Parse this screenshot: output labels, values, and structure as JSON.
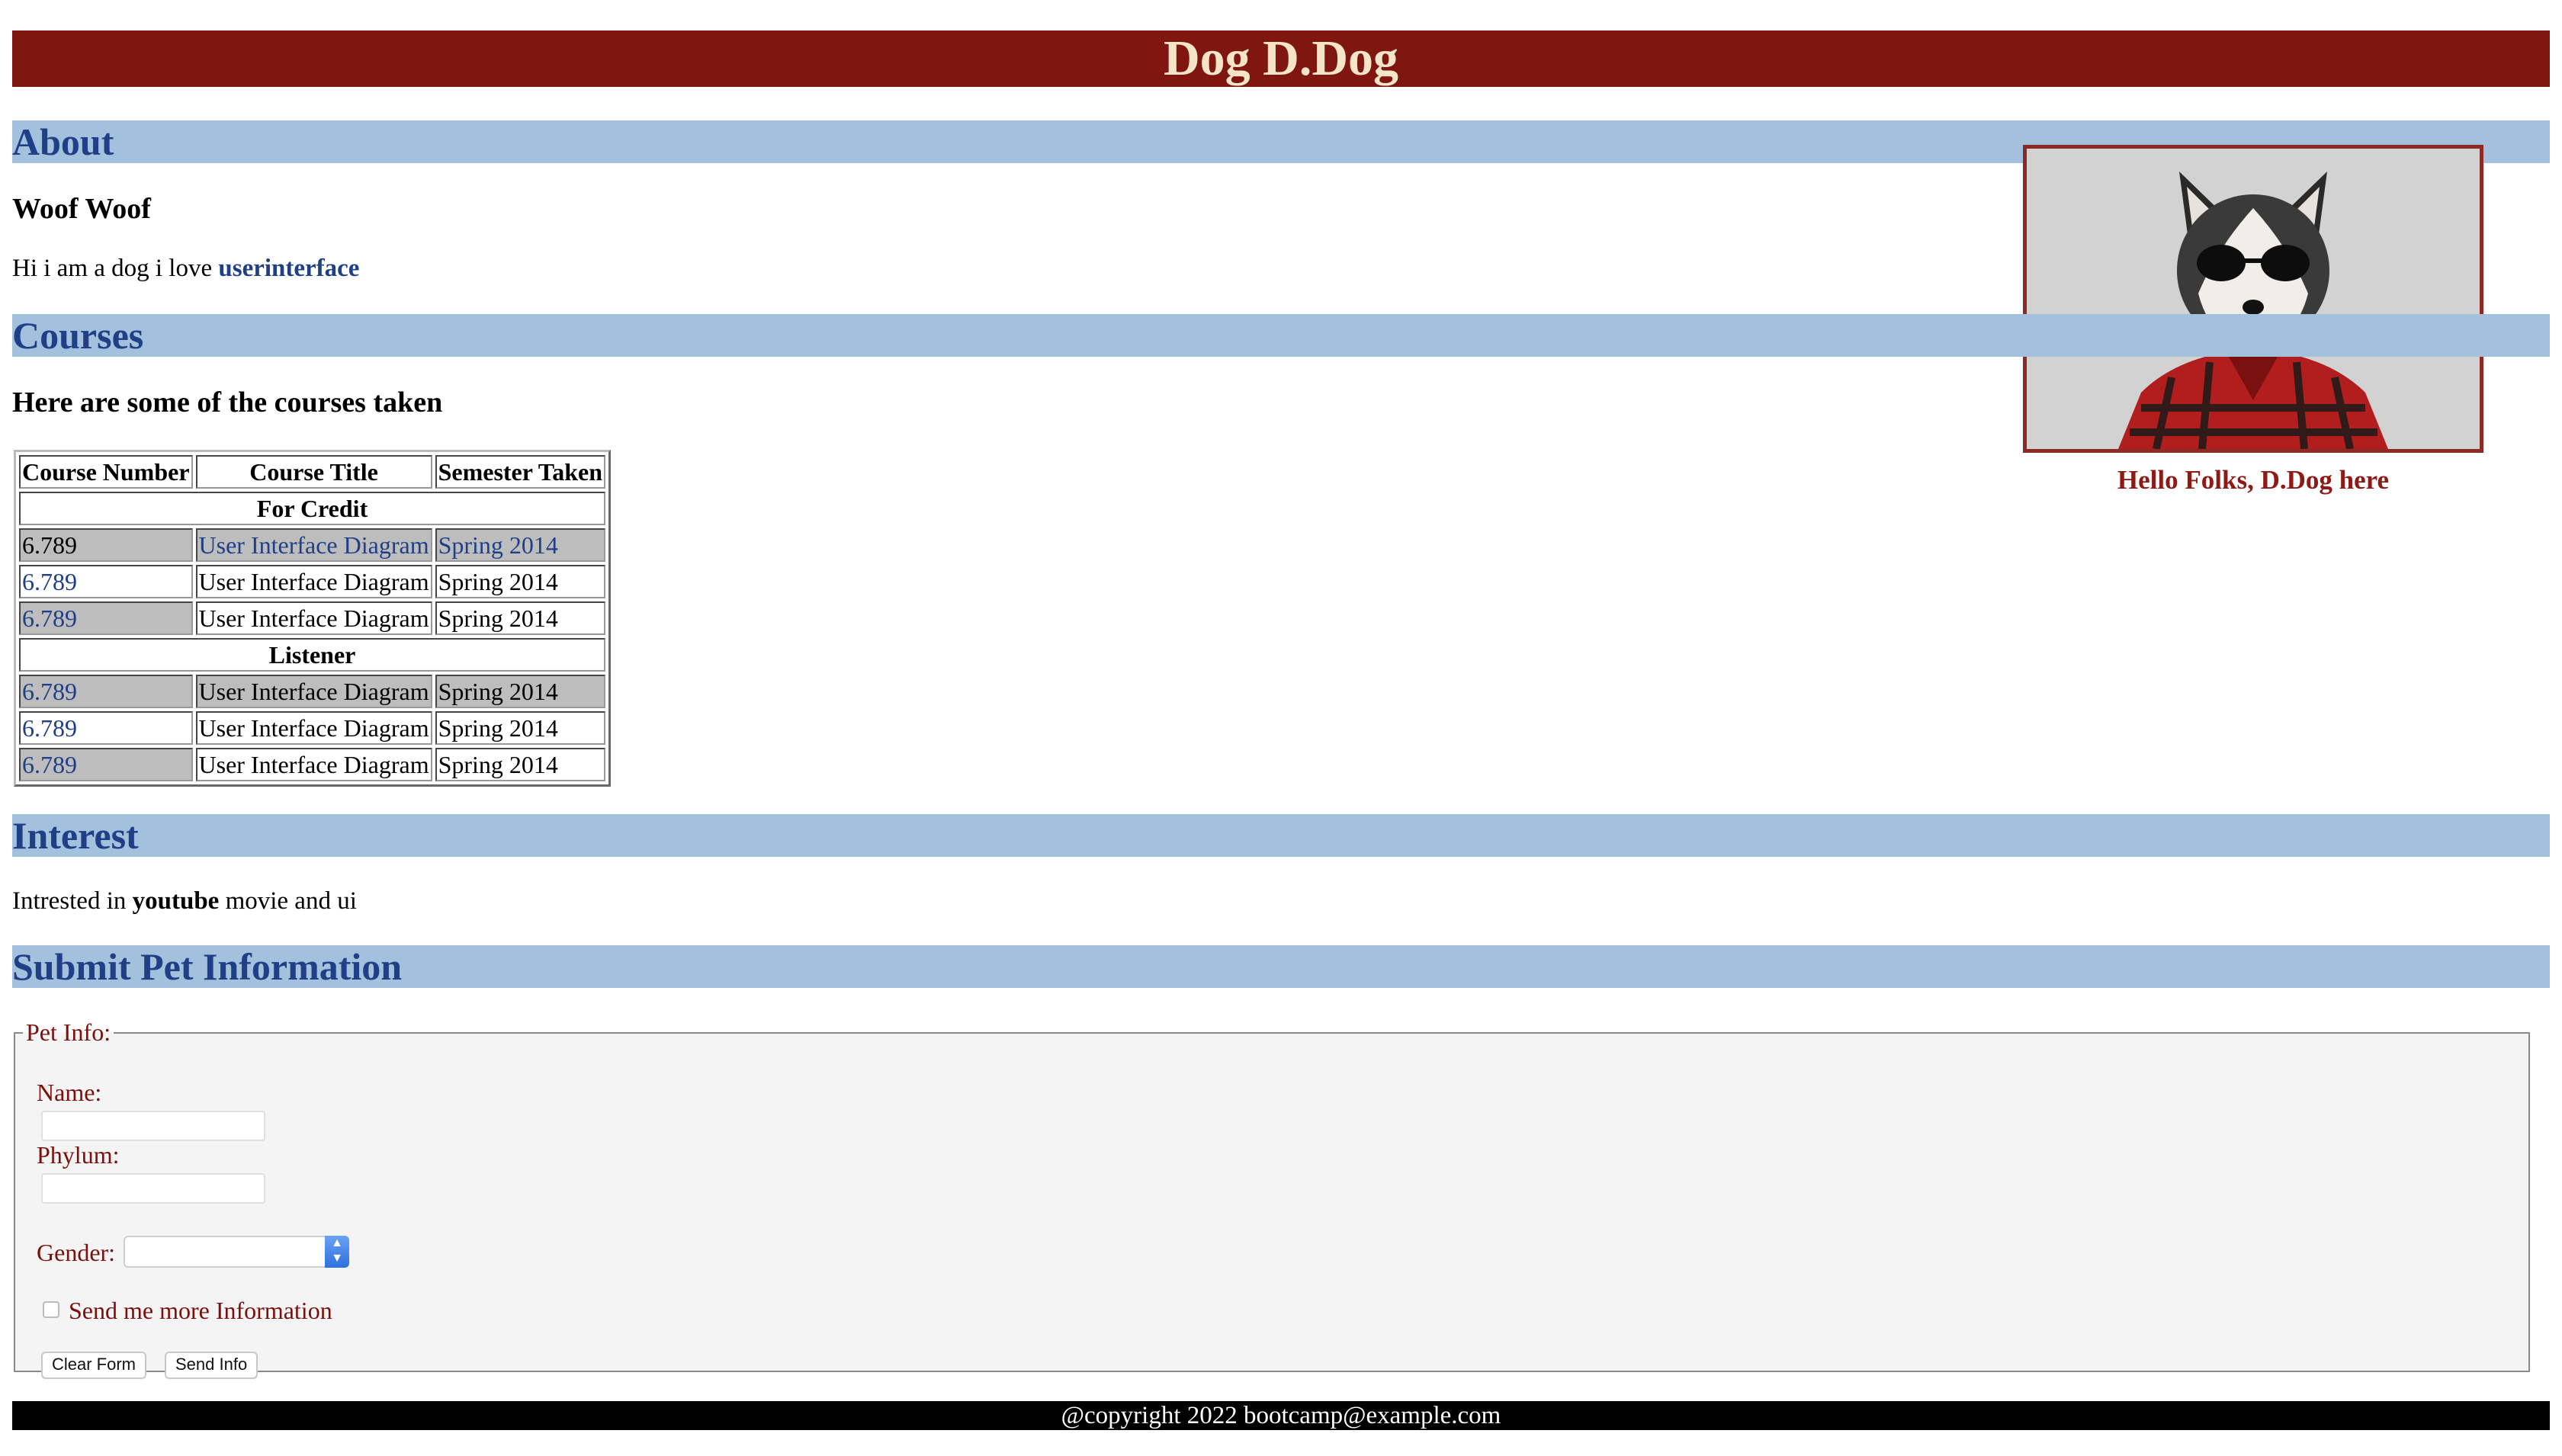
{
  "header": {
    "title": "Dog D.Dog"
  },
  "about": {
    "heading": "About",
    "subheading": "Woof Woof",
    "text_before_link": "Hi i am a dog i love ",
    "link_text": "userinterface"
  },
  "photo": {
    "caption": "Hello Folks, D.Dog here"
  },
  "courses": {
    "heading": "Courses",
    "subheading": "Here are some of the courses taken",
    "columns": [
      "Course Number",
      "Course Title",
      "Semester Taken"
    ],
    "groups": [
      "For Credit",
      "Listener"
    ],
    "rows": [
      [
        "6.789",
        "User Interface Diagram",
        "Spring 2014"
      ],
      [
        "6.789",
        "User Interface Diagram",
        "Spring 2014"
      ],
      [
        "6.789",
        "User Interface Diagram",
        "Spring 2014"
      ],
      [
        "6.789",
        "User Interface Diagram",
        "Spring 2014"
      ],
      [
        "6.789",
        "User Interface Diagram",
        "Spring 2014"
      ],
      [
        "6.789",
        "User Interface Diagram",
        "Spring 2014"
      ]
    ]
  },
  "interest": {
    "heading": "Interest",
    "text_before": "Intrested in ",
    "bold": "youtube",
    "text_after": " movie and ui"
  },
  "form": {
    "heading": "Submit Pet Information",
    "legend": "Pet Info:",
    "name_label": "Name:",
    "phylum_label": "Phylum:",
    "gender_label": "Gender:",
    "checkbox_label": "Send me more Information",
    "clear_button": "Clear Form",
    "send_button": "Send Info"
  },
  "footer": {
    "text": "@copyright 2022 bootcamp@example.com"
  },
  "colors": {
    "title_bar": "#7f1610",
    "section_bar": "#a3c1dc",
    "heading_text": "#1f3f87",
    "form_label": "#7a0f0b"
  }
}
